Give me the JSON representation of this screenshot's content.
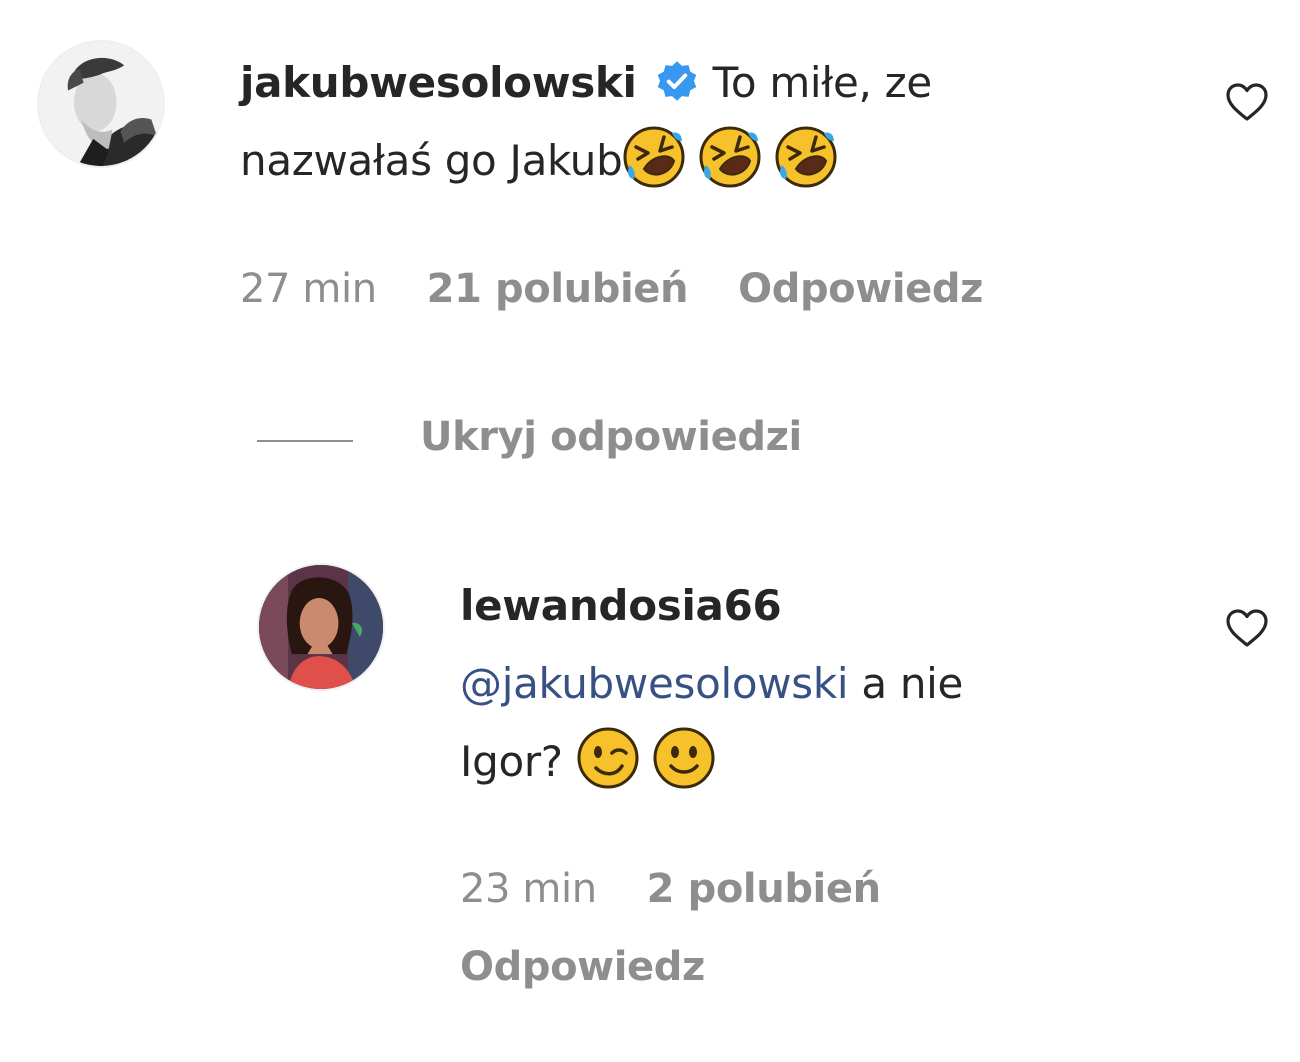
{
  "comments": [
    {
      "username": "jakubwesolowski",
      "verified": true,
      "avatar_icon": "user-avatar-grayscale",
      "text_part1": "To miłe, ze",
      "text_part2": "nazwałaś go Jakub",
      "emojis": [
        "rolling-on-floor-laughing",
        "rolling-on-floor-laughing",
        "rolling-on-floor-laughing"
      ],
      "time": "27 min",
      "likes": "21 polubień",
      "reply_label": "Odpowiedz",
      "liked": false
    }
  ],
  "replies_toggle": {
    "label": "Ukryj odpowiedzi"
  },
  "replies": [
    {
      "username": "lewandosia66",
      "verified": false,
      "avatar_icon": "user-avatar-photo",
      "mention": "@jakubwesolowski",
      "text_part1": "a nie",
      "text_part2": "Igor?",
      "emojis": [
        "winking-face",
        "slightly-smiling-face"
      ],
      "time": "23 min",
      "likes": "2 polubień",
      "reply_label": "Odpowiedz",
      "liked": false
    }
  ],
  "colors": {
    "text_primary": "#262626",
    "text_secondary": "#8e8e8e",
    "mention": "#385185",
    "verified_badge": "#3897f0"
  }
}
